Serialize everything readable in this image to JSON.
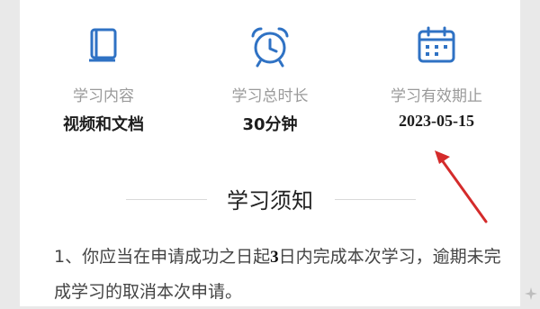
{
  "stats": [
    {
      "label": "学习内容",
      "value": "视频和文档",
      "icon": "book-icon"
    },
    {
      "label": "学习总时长",
      "value": "30分钟",
      "icon": "alarm-clock-icon"
    },
    {
      "label": "学习有效期止",
      "value": "2023-05-15",
      "icon": "calendar-icon"
    }
  ],
  "notice": {
    "title": "学习须知",
    "text_before": "1、你应当在申请成功之日起",
    "text_highlight": "3",
    "text_after": "日内完成本次学习，逾期未完成学习的取消本次申请。"
  },
  "colors": {
    "accent": "#2f72c4",
    "annotation_arrow": "#d42b2b"
  }
}
